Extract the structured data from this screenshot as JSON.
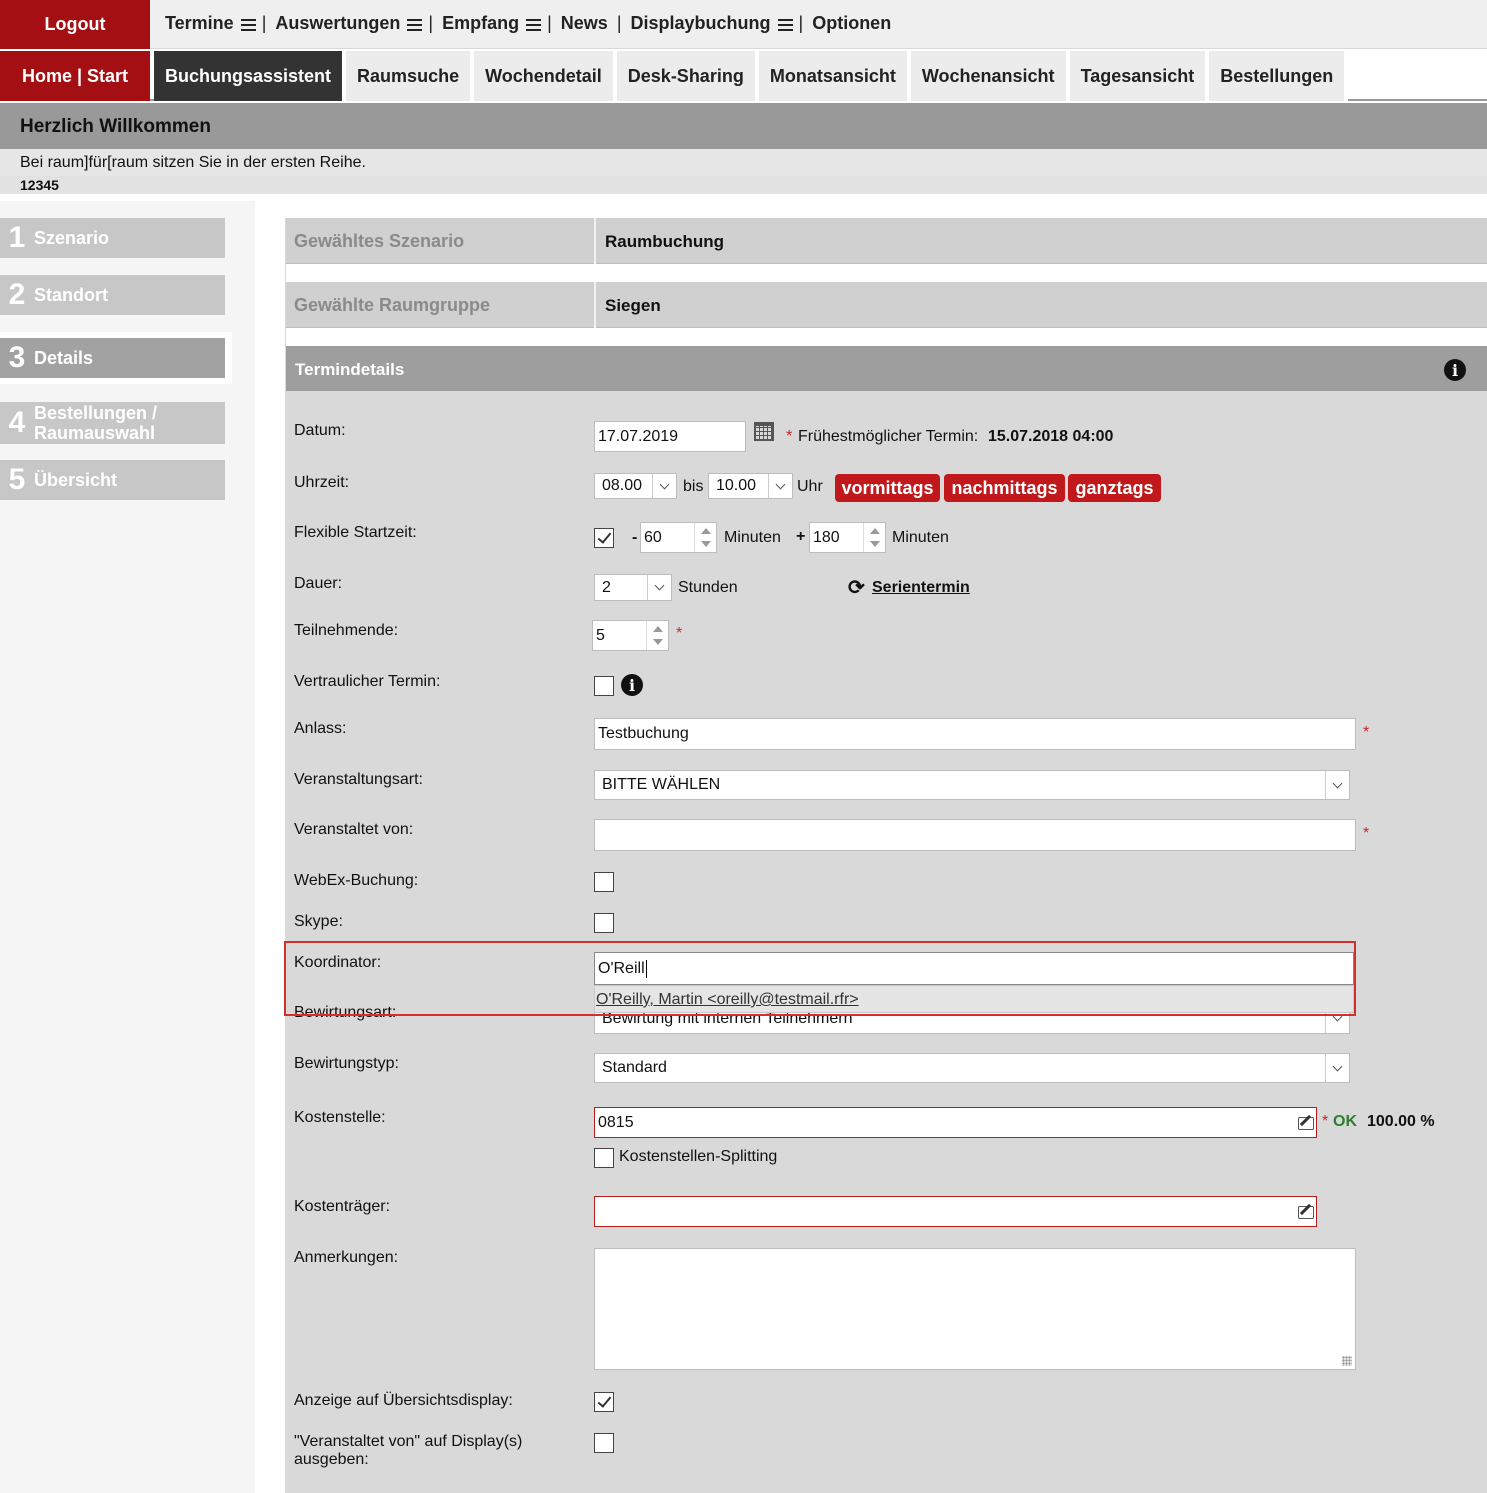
{
  "header": {
    "logout": "Logout",
    "home": "Home |",
    "start": "Start",
    "topnav": [
      {
        "label": "Termine",
        "menu": true,
        "sep": "|"
      },
      {
        "label": "Auswertungen",
        "menu": true,
        "sep": "|"
      },
      {
        "label": "Empfang",
        "menu": true,
        "sep": "|"
      },
      {
        "label": "News",
        "menu": false,
        "sep": "|"
      },
      {
        "label": "Displaybuchung",
        "menu": true,
        "sep": "|"
      },
      {
        "label": "Optionen",
        "menu": false,
        "sep": ""
      }
    ],
    "tabs": [
      "Buchungsassistent",
      "Raumsuche",
      "Wochendetail",
      "Desk-Sharing",
      "Monatsansicht",
      "Wochenansicht",
      "Tagesansicht",
      "Bestellungen"
    ],
    "active_tab": "Buchungsassistent"
  },
  "welcome": {
    "title": "Herzlich Willkommen",
    "text": "Bei raum]für[raum sitzen Sie in der ersten Reihe.",
    "code": "12345"
  },
  "steps": [
    {
      "num": "1",
      "label": "Szenario"
    },
    {
      "num": "2",
      "label": "Standort"
    },
    {
      "num": "3",
      "label": "Details"
    },
    {
      "num": "4",
      "label": "Bestellungen / Raumauswahl"
    },
    {
      "num": "5",
      "label": "Übersicht"
    }
  ],
  "summary": {
    "scenario_key": "Gewähltes Szenario",
    "scenario_value": "Raumbuchung",
    "group_key": "Gewählte Raumgruppe",
    "group_value": "Siegen"
  },
  "section_title": "Termindetails",
  "form": {
    "datum_label": "Datum:",
    "datum_value": "17.07.2019",
    "earliest_label": "Frühestmöglicher Termin:",
    "earliest_value": "15.07.2018 04:00",
    "uhrzeit_label": "Uhrzeit:",
    "time_from": "08.00",
    "bis": "bis",
    "time_to": "10.00",
    "uhr": "Uhr",
    "btn_vormittags": "vormittags",
    "btn_nachmittags": "nachmittags",
    "btn_ganztags": "ganztags",
    "flex_label": "Flexible Startzeit:",
    "flex_minus_sign": "-",
    "flex_minus": "60",
    "minuten1": "Minuten",
    "flex_plus_sign": "+",
    "flex_plus": "180",
    "minuten2": "Minuten",
    "dauer_label": "Dauer:",
    "dauer_value": "2",
    "stunden": "Stunden",
    "serientermin": "Serientermin",
    "teilnehmende_label": "Teilnehmende:",
    "teilnehmende_value": "5",
    "vertraulich_label": "Vertraulicher Termin:",
    "anlass_label": "Anlass:",
    "anlass_value": "Testbuchung",
    "veranstaltungsart_label": "Veranstaltungsart:",
    "veranstaltungsart_value": "BITTE WÄHLEN",
    "veranstaltet_label": "Veranstaltet von:",
    "veranstaltet_value": "",
    "webex_label": "WebEx-Buchung:",
    "skype_label": "Skype:",
    "koordinator_label": "Koordinator:",
    "koordinator_value": "O'Reill",
    "koordinator_suggestion": "O'Reilly, Martin <oreilly@testmail.rfr>",
    "bewirtungsart_label": "Bewirtungsart:",
    "bewirtungsart_value": "Bewirtung mit internen Teilnehmern",
    "bewirtungstyp_label": "Bewirtungstyp:",
    "bewirtungstyp_value": "Standard",
    "kostenstelle_label": "Kostenstelle:",
    "kostenstelle_value": "0815",
    "ok": "OK",
    "percent": "100.00 %",
    "splitting_label": "Kostenstellen-Splitting",
    "kostentraeger_label": "Kostenträger:",
    "kostentraeger_value": "",
    "anmerkungen_label": "Anmerkungen:",
    "anmerkungen_value": "",
    "anzeige_label": "Anzeige auf Übersichtsdisplay:",
    "display_label_1": "\"Veranstaltet von\" auf Display(s)",
    "display_label_2": "ausgeben:",
    "required": "*"
  },
  "colors": {
    "brand": "#a30f12",
    "button_red": "#c1181c",
    "ok_green": "#2e7d32",
    "highlight": "#d32f2f"
  }
}
